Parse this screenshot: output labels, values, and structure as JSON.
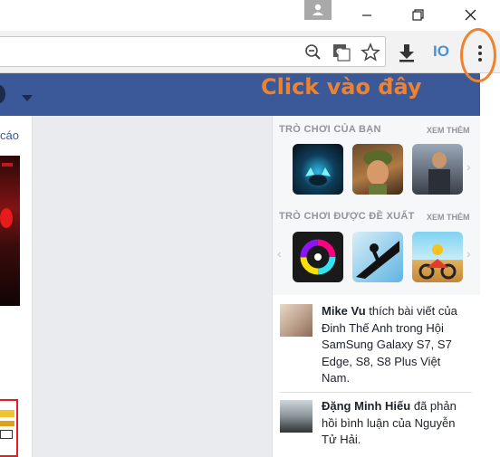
{
  "window": {
    "minimize_glyph": "—",
    "restore_glyph": "❐",
    "close_glyph": "✕"
  },
  "toolbar": {
    "zoom_icon": "zoom-out-icon",
    "translate_icon": "translate-icon",
    "bookmark_icon": "star-icon",
    "download_icon": "download-icon",
    "extension_label": "IO",
    "menu_icon": "kebab-menu-icon"
  },
  "annotation": {
    "callout": "Click vào đây",
    "color": "#f0822d"
  },
  "left": {
    "ad_text": "cáo"
  },
  "games": {
    "your_games_title": "TRÒ CHƠI CỦA BẠN",
    "your_games_more": "XEM THÊM",
    "suggested_title": "TRÒ CHƠI ĐƯỢC ĐỀ XUẤT",
    "suggested_more": "XEM THÊM",
    "next_arrow": "›",
    "prev_arrow": "‹"
  },
  "feed": {
    "story1": {
      "name": "Mike Vu",
      "text": "thích bài viết của Đinh Thế Anh trong Hội SamSung Galaxy S7, S7 Edge, S8, S8 Plus Việt Nam."
    },
    "story2": {
      "name": "Đặng Minh Hiếu",
      "text": "đã phản hồi bình luận của Nguyễn Tử Hải."
    }
  },
  "colors": {
    "facebook_blue": "#3b5998",
    "link_blue": "#365899"
  }
}
